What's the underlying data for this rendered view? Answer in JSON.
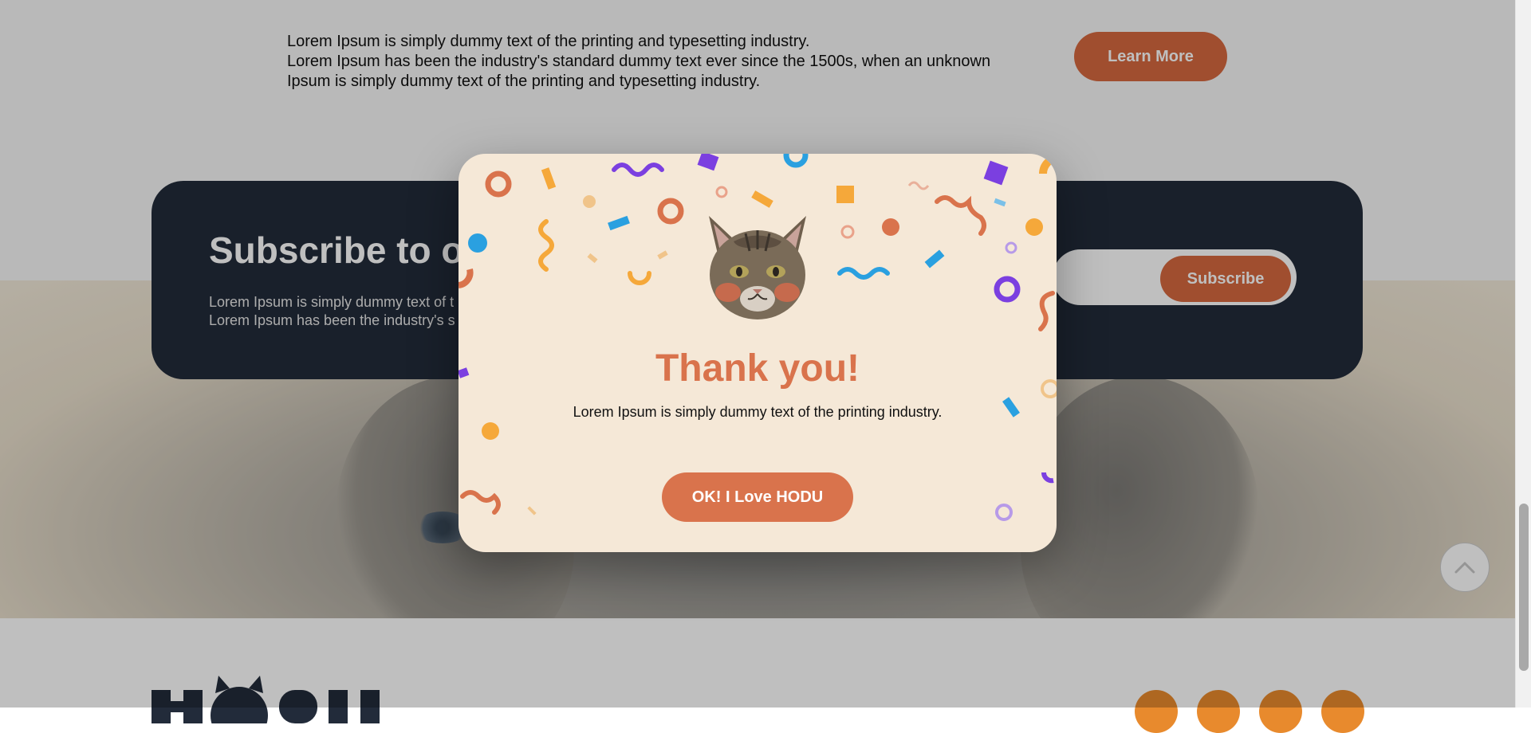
{
  "intro": {
    "lines": [
      "Lorem Ipsum is simply dummy text of the printing and typesetting industry.",
      "Lorem Ipsum has been the industry's standard dummy text ever since the 1500s, when an unknown",
      "Ipsum is simply dummy text of the printing and typesetting industry."
    ],
    "learn_more_label": "Learn More"
  },
  "subscribe": {
    "title": "Subscribe to ou",
    "desc_lines": [
      "Lorem Ipsum is simply dummy text of t",
      "Lorem Ipsum has been the industry's s"
    ],
    "button_label": "Subscribe"
  },
  "modal": {
    "title": "Thank you!",
    "text": "Lorem Ipsum is simply dummy text of the printing industry.",
    "button_label": "OK! I Love HODU"
  },
  "footer": {
    "logo_text": "HODU",
    "social_icons": [
      "linkedin-icon",
      "instagram-icon",
      "facebook-icon",
      "youtube-icon"
    ]
  },
  "icons": {
    "scroll_top": "chevron-up-icon"
  },
  "colors": {
    "accent": "#d6683f",
    "dark_card": "#222b3a",
    "modal_bg": "#f5e8d7",
    "social": "#e88a2d"
  }
}
